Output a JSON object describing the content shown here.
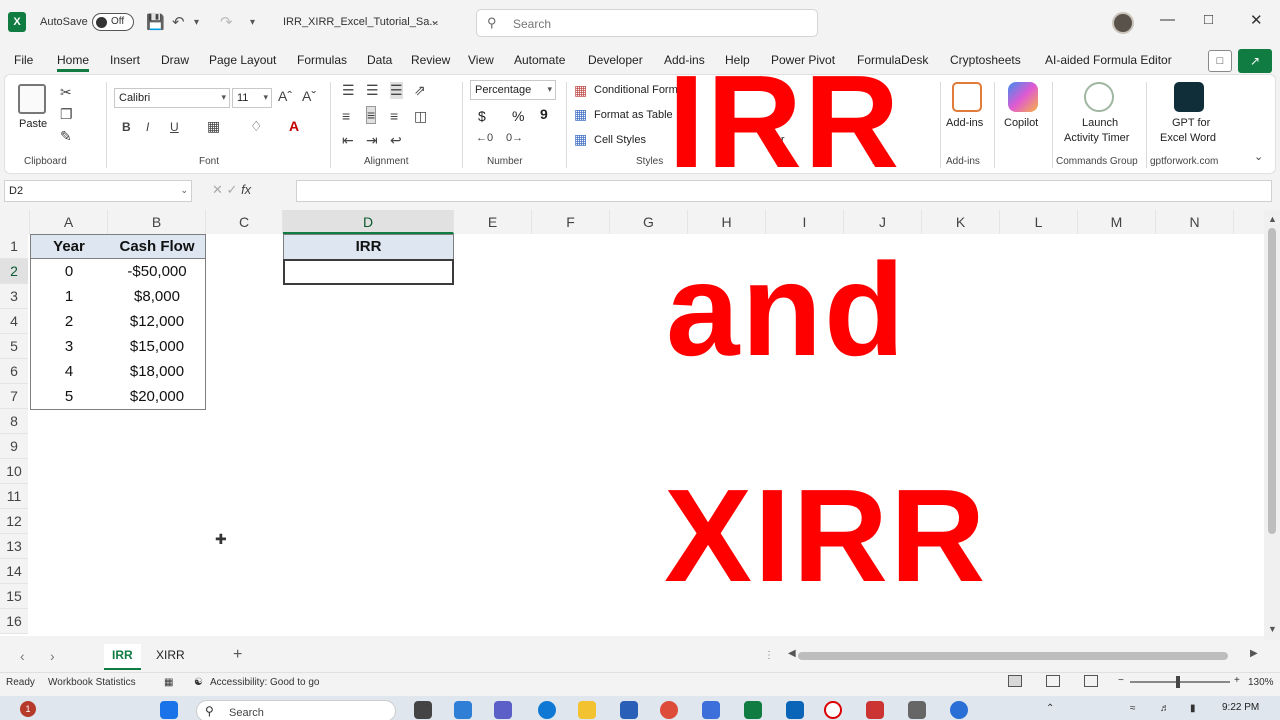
{
  "titlebar": {
    "autosave_label": "AutoSave",
    "autosave_state": "Off",
    "filename": "IRR_XIRR_Excel_Tutorial_Sa...",
    "search_placeholder": "Search"
  },
  "menu": {
    "tabs": [
      "File",
      "Home",
      "Insert",
      "Draw",
      "Page Layout",
      "Formulas",
      "Data",
      "Review",
      "View",
      "Automate",
      "Developer",
      "Add-ins",
      "Help",
      "Power Pivot",
      "FormulaDesk",
      "Cryptosheets",
      "AI-aided Formula Editor"
    ],
    "active": "Home"
  },
  "ribbon": {
    "clipboard": {
      "paste": "Paste",
      "label": "Clipboard"
    },
    "font": {
      "name": "Calibri",
      "size": "11",
      "label": "Font"
    },
    "alignment": {
      "label": "Alignment"
    },
    "number": {
      "format": "Percentage",
      "currency": "$",
      "percent": "%",
      "comma": "9",
      "label": "Number"
    },
    "styles": {
      "conditional": "Conditional Form",
      "format_table": "Format as Table",
      "cell_styles": "Cell Styles",
      "label": "Styles"
    },
    "cells": {
      "label": "Cel",
      "item": "For"
    },
    "editing": {
      "label": "iting"
    },
    "addins": {
      "item": "Add-ins",
      "label": "Add-ins"
    },
    "copilot": {
      "item": "Copilot"
    },
    "commands": {
      "item_line1": "Launch",
      "item_line2": "Activity Timer",
      "label": "Commands Group"
    },
    "gpt": {
      "item_line1": "GPT for",
      "item_line2": "Excel Word",
      "label": "gptforwork.com"
    }
  },
  "formula_bar": {
    "name_box": "D2",
    "fx": "fx",
    "value": ""
  },
  "grid": {
    "columns": [
      "A",
      "B",
      "C",
      "D",
      "E",
      "F",
      "G",
      "H",
      "I",
      "J",
      "K",
      "L",
      "M",
      "N"
    ],
    "selected_column": "D",
    "rows": [
      "1",
      "2",
      "3",
      "4",
      "5",
      "6",
      "7",
      "8",
      "9",
      "10",
      "11",
      "12",
      "13",
      "14",
      "15",
      "16"
    ],
    "table": {
      "headers": [
        "Year",
        "Cash Flow"
      ],
      "rows": [
        [
          "0",
          "-$50,000"
        ],
        [
          "1",
          "$8,000"
        ],
        [
          "2",
          "$12,000"
        ],
        [
          "3",
          "$15,000"
        ],
        [
          "4",
          "$18,000"
        ],
        [
          "5",
          "$20,000"
        ]
      ]
    },
    "irr_header": "IRR",
    "irr_value": ""
  },
  "overlay": {
    "line1": "IRR",
    "line2": "and",
    "line3": "XIRR",
    "color": "#ff0000"
  },
  "sheets": {
    "tabs": [
      "IRR",
      "XIRR"
    ],
    "active": "IRR",
    "add": "+"
  },
  "status": {
    "ready": "Ready",
    "workbook_stats": "Workbook Statistics",
    "accessibility": "Accessibility: Good to go",
    "zoom": "130%",
    "zoom_fraction": 0.48
  },
  "taskbar": {
    "search_placeholder": "Search",
    "time": "9:22 PM",
    "notification_badge": "1"
  }
}
